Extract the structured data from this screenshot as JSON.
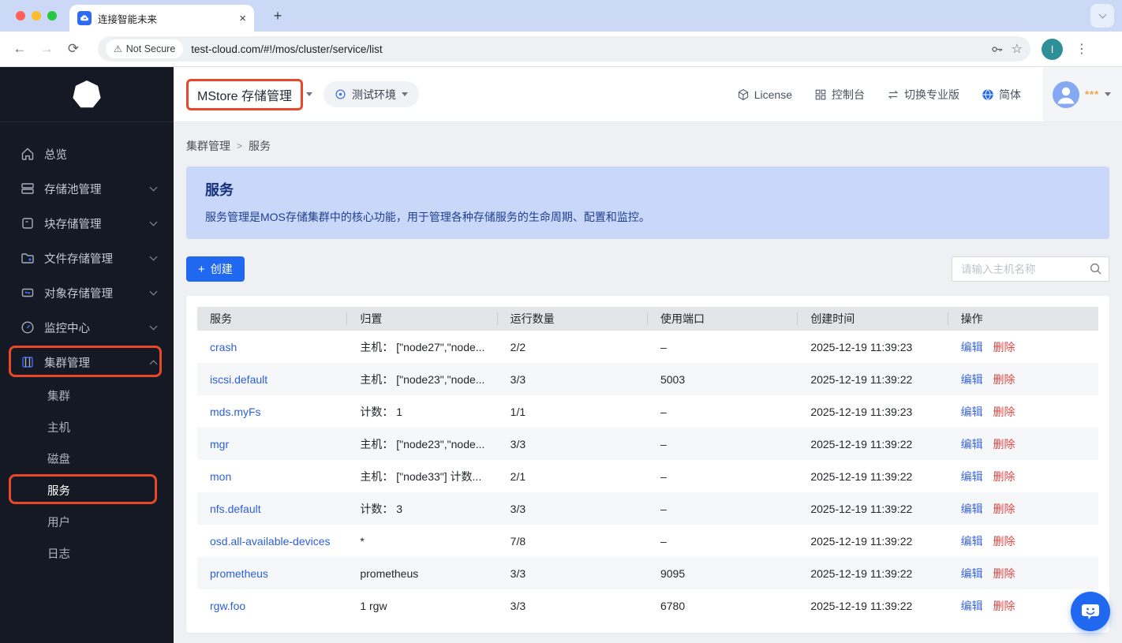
{
  "icons": {
    "back": "←",
    "forward": "→",
    "reload": "⟳",
    "warning": "⚠",
    "star": "☆",
    "kebab": "⋮",
    "close": "×",
    "new_tab": "+"
  },
  "browser": {
    "tab_title": "连接智能未来",
    "security_label": "Not Secure",
    "url": "test-cloud.com/#!/mos/cluster/service/list",
    "profile_initial": "I"
  },
  "sidebar": {
    "items": [
      {
        "label": "总览"
      },
      {
        "label": "存储池管理"
      },
      {
        "label": "块存储管理"
      },
      {
        "label": "文件存储管理"
      },
      {
        "label": "对象存储管理"
      },
      {
        "label": "监控中心"
      },
      {
        "label": "集群管理"
      }
    ],
    "sub_items": [
      {
        "label": "集群"
      },
      {
        "label": "主机"
      },
      {
        "label": "磁盘"
      },
      {
        "label": "服务"
      },
      {
        "label": "用户"
      },
      {
        "label": "日志"
      }
    ]
  },
  "header": {
    "app_title": "MStore 存储管理",
    "environment": "测试环境",
    "license": "License",
    "console": "控制台",
    "switch_pro": "切换专业版",
    "language": "简体",
    "user_masked": "***"
  },
  "breadcrumb": {
    "parent": "集群管理",
    "separator": ">",
    "current": "服务"
  },
  "banner": {
    "title": "服务",
    "description": "服务管理是MOS存储集群中的核心功能，用于管理各种存储服务的生命周期、配置和监控。"
  },
  "actions": {
    "create_label": "创建",
    "create_icon": "+",
    "search_placeholder": "请输入主机名称"
  },
  "table": {
    "columns": [
      "服务",
      "归置",
      "运行数量",
      "使用端口",
      "创建时间",
      "操作"
    ],
    "edit_label": "编辑",
    "delete_label": "删除",
    "rows": [
      {
        "service": "crash",
        "placement": "主机： [\"node27\",\"node...",
        "running": "2/2",
        "port": "–",
        "created": "2025-12-19 11:39:23"
      },
      {
        "service": "iscsi.default",
        "placement": "主机： [\"node23\",\"node...",
        "running": "3/3",
        "port": "5003",
        "created": "2025-12-19 11:39:22"
      },
      {
        "service": "mds.myFs",
        "placement": "计数： 1",
        "running": "1/1",
        "port": "–",
        "created": "2025-12-19 11:39:23"
      },
      {
        "service": "mgr",
        "placement": "主机： [\"node23\",\"node...",
        "running": "3/3",
        "port": "–",
        "created": "2025-12-19 11:39:22"
      },
      {
        "service": "mon",
        "placement": "主机： [\"node33\"] 计数...",
        "running": "2/1",
        "port": "–",
        "created": "2025-12-19 11:39:22"
      },
      {
        "service": "nfs.default",
        "placement": "计数： 3",
        "running": "3/3",
        "port": "–",
        "created": "2025-12-19 11:39:22"
      },
      {
        "service": "osd.all-available-devices",
        "placement": "*",
        "running": "7/8",
        "port": "–",
        "created": "2025-12-19 11:39:22"
      },
      {
        "service": "prometheus",
        "placement": "prometheus",
        "running": "3/3",
        "port": "9095",
        "created": "2025-12-19 11:39:22"
      },
      {
        "service": "rgw.foo",
        "placement": "1 rgw",
        "running": "3/3",
        "port": "6780",
        "created": "2025-12-19 11:39:22"
      }
    ]
  }
}
